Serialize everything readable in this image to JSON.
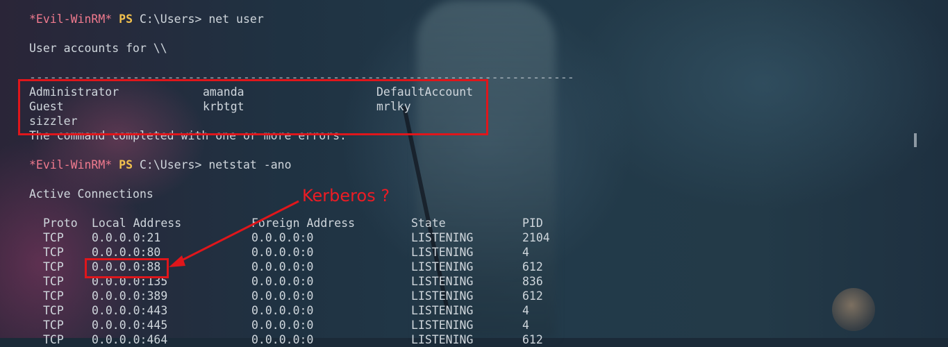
{
  "colors": {
    "prompt_evil": "#f07a8e",
    "prompt_ps": "#f2c14e",
    "text": "#cfd6dc",
    "annotation": "#ec1c24"
  },
  "cmd1": {
    "evil": "*Evil-WinRM*",
    "ps": "PS",
    "path": "C:\\Users>",
    "command": "net user"
  },
  "user_accounts_header": "User accounts for \\\\",
  "divider": "-------------------------------------------------------------------------------",
  "users": {
    "col1": [
      "Administrator",
      "Guest",
      "sizzler"
    ],
    "col2": [
      "amanda",
      "krbtgt"
    ],
    "col3": [
      "DefaultAccount",
      "mrlky"
    ]
  },
  "completion_msg": "The command completed with one or more errors.",
  "cmd2": {
    "evil": "*Evil-WinRM*",
    "ps": "PS",
    "path": "C:\\Users>",
    "command": "netstat -ano"
  },
  "active_connections": "Active Connections",
  "netstat": {
    "headers": [
      "Proto",
      "Local Address",
      "Foreign Address",
      "State",
      "PID"
    ],
    "rows": [
      [
        "TCP",
        "0.0.0.0:21",
        "0.0.0.0:0",
        "LISTENING",
        "2104"
      ],
      [
        "TCP",
        "0.0.0.0:80",
        "0.0.0.0:0",
        "LISTENING",
        "4"
      ],
      [
        "TCP",
        "0.0.0.0:88",
        "0.0.0.0:0",
        "LISTENING",
        "612"
      ],
      [
        "TCP",
        "0.0.0.0:135",
        "0.0.0.0:0",
        "LISTENING",
        "836"
      ],
      [
        "TCP",
        "0.0.0.0:389",
        "0.0.0.0:0",
        "LISTENING",
        "612"
      ],
      [
        "TCP",
        "0.0.0.0:443",
        "0.0.0.0:0",
        "LISTENING",
        "4"
      ],
      [
        "TCP",
        "0.0.0.0:445",
        "0.0.0.0:0",
        "LISTENING",
        "4"
      ],
      [
        "TCP",
        "0.0.0.0:464",
        "0.0.0.0:0",
        "LISTENING",
        "612"
      ]
    ]
  },
  "annotation": "Kerberos ?"
}
